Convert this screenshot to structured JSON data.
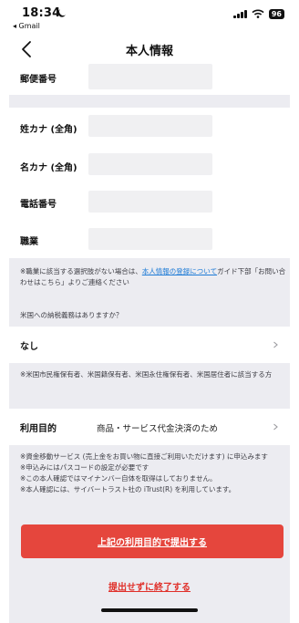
{
  "status_bar": {
    "time": "18:34",
    "back_app": "◂ Gmail",
    "battery": "96"
  },
  "nav": {
    "title": "本人情報"
  },
  "form": {
    "postal_label": "郵便番号",
    "sei_kana_label": "姓カナ (全角)",
    "mei_kana_label": "名カナ (全角)",
    "phone_label": "電話番号",
    "occupation_label": "職業"
  },
  "notes": {
    "occupation_prefix": "※職業に該当する選択肢がない場合は、",
    "occupation_link": "本人情報の登録について",
    "occupation_suffix": "ガイド下部「お問い合わせはこちら」よりご連絡ください",
    "tax_question": "米国への納税義務はありますか？",
    "us_person": "※米国市民権保有者、米国籍保有者、米国永住権保有者、米国居住者に該当する方",
    "funds_transfer": "※資金移動サービス (売上金をお買い物に直接ご利用いただけます) に申込みます",
    "passcode": "※申込みにはパスコードの設定が必要です",
    "my_number": "※この本人確認ではマイナンバー自体を取得はしておりません。",
    "itrust": "※本人確認には、サイバートラスト社の iTrust(R) を利用しています。"
  },
  "tax": {
    "selected": "なし"
  },
  "purpose": {
    "label": "利用目的",
    "value": "商品・サービス代金決済のため"
  },
  "actions": {
    "submit": "上記の利用目的で提出する",
    "exit": "提出せずに終了する"
  },
  "colors": {
    "primary": "#e5463d",
    "link": "#1e7bd6",
    "background": "#ececf1"
  }
}
